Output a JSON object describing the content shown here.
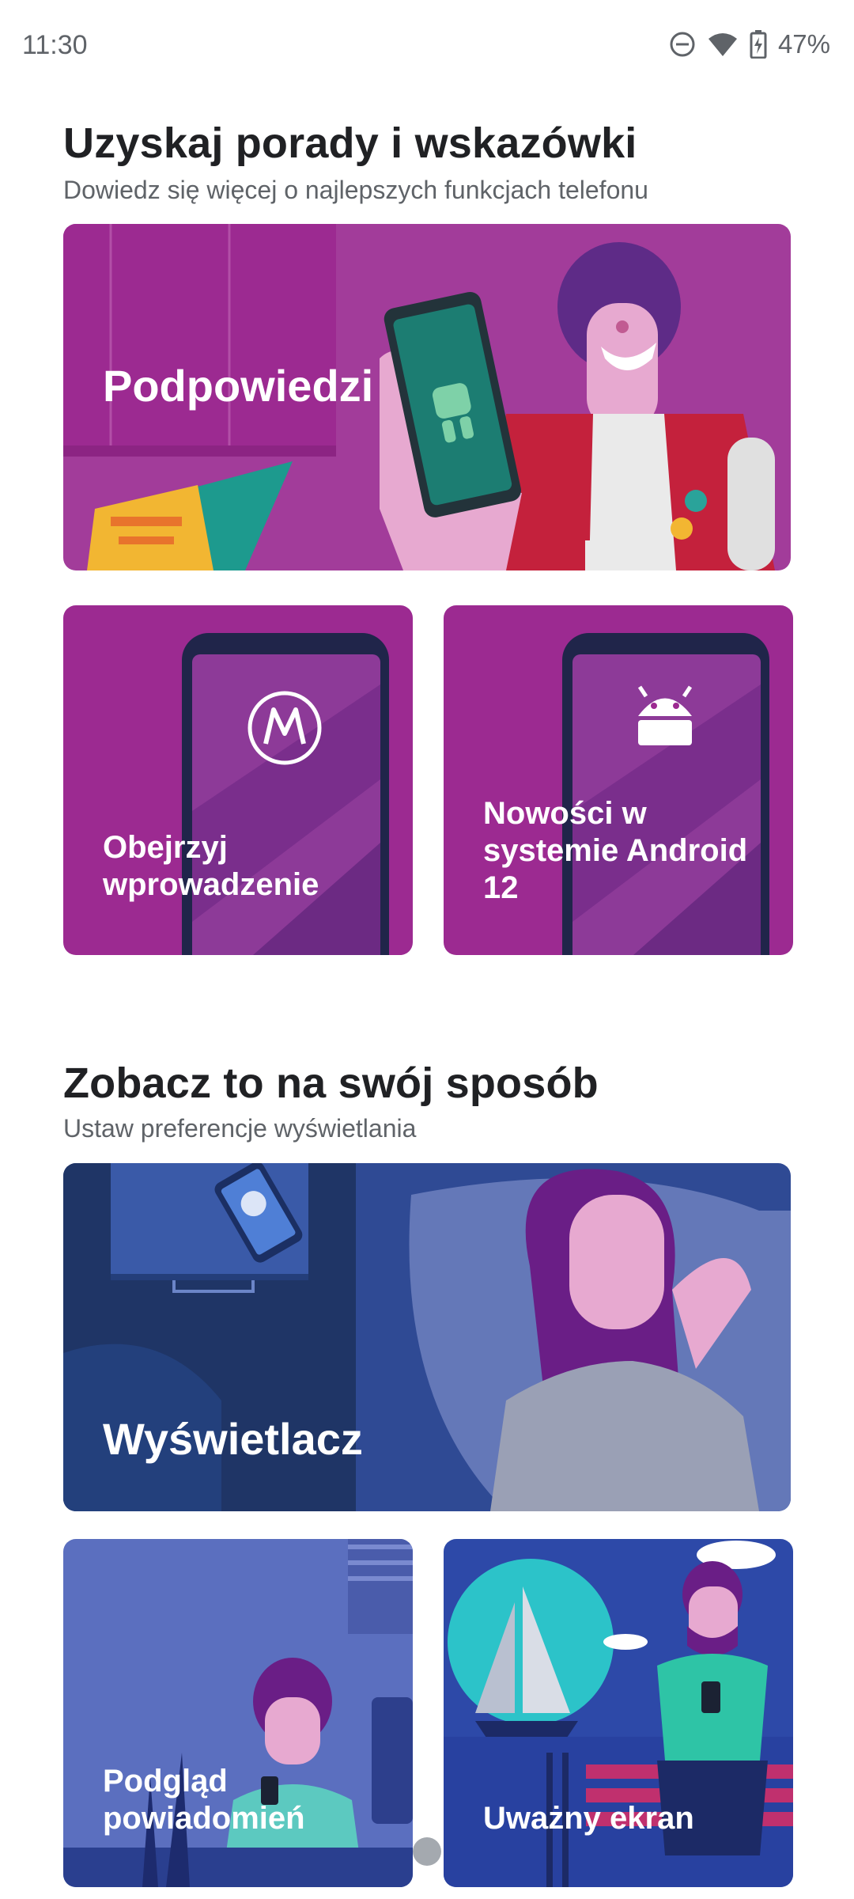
{
  "status_bar": {
    "time": "11:30",
    "battery": "47%",
    "icons": [
      "do-not-disturb-icon",
      "wifi-icon",
      "battery-charging-icon"
    ]
  },
  "section_tips": {
    "title": "Uzyskaj porady i wskazówki",
    "subtitle": "Dowiedz się więcej o najlepszych funkcjach telefonu",
    "cards": {
      "hints": "Podpowiedzi",
      "intro_line1": "Obejrzyj",
      "intro_line2": "wprowadzenie",
      "android_line1": "Nowości w",
      "android_line2": "systemie Android",
      "android_line3": "12"
    }
  },
  "section_display": {
    "title": "Zobacz to na swój sposób",
    "subtitle": "Ustaw preferencje wyświetlania",
    "cards": {
      "display": "Wyświetlacz",
      "peek_line1": "Podgląd",
      "peek_line2": "powiadomień",
      "attentive": "Uważny ekran"
    }
  },
  "colors": {
    "magenta": "#9c2a91",
    "navy": "#1f3566",
    "blue": "#2d49a8"
  }
}
